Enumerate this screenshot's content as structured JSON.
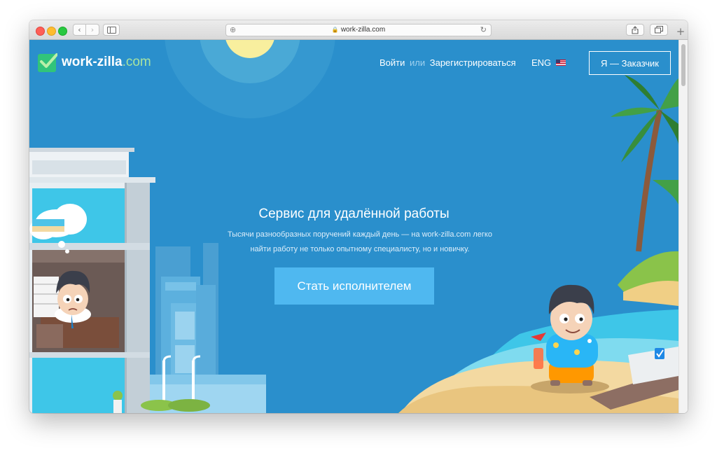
{
  "browser": {
    "url": "work-zilla.com",
    "back_icon": "‹",
    "forward_icon": "›"
  },
  "site": {
    "logo_name": "work-zilla",
    "logo_domain": ".com",
    "colors": {
      "background": "#2a8fcc",
      "accent": "#4fb8f0",
      "logo_green": "#31c47a"
    }
  },
  "nav": {
    "login": "Войти",
    "or": "или",
    "register": "Зарегистрироваться",
    "language": "ENG",
    "client_button": "Я — Заказчик"
  },
  "hero": {
    "title": "Сервис для удалённой работы",
    "subtitle_line1": "Тысячи разнообразных поручений каждый день — на work-zilla.com легко",
    "subtitle_line2": "найти работу не только опытному специалисту, но и новичку.",
    "cta": "Стать исполнителем"
  }
}
